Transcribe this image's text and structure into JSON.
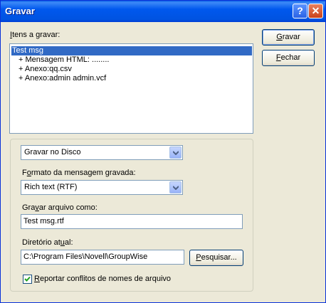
{
  "window": {
    "title": "Gravar",
    "help_glyph": "?",
    "close_glyph": "✕"
  },
  "items_label": {
    "hotkey": "I",
    "rest": "tens a gravar:"
  },
  "items": [
    {
      "label": "Test msg",
      "selected": true
    },
    {
      "label": "+ Mensagem HTML: ........"
    },
    {
      "label": "+ Anexo:qq.csv"
    },
    {
      "label": "+ Anexo:admin admin.vcf"
    }
  ],
  "buttons": {
    "save": {
      "hotkey": "G",
      "rest": "ravar"
    },
    "close": {
      "hotkey": "F",
      "rest": "echar"
    },
    "browse": {
      "hotkey": "P",
      "rest": "esquisar..."
    }
  },
  "destination": {
    "selected": "Gravar no Disco"
  },
  "format": {
    "label_pre": "F",
    "label_hot": "o",
    "label_post": "rmato da mensagem gravada:",
    "selected": "Rich text (RTF)"
  },
  "filename": {
    "label_pre": "Gra",
    "label_hot": "v",
    "label_post": "ar arquivo como:",
    "value": "Test msg.rtf"
  },
  "directory": {
    "label_pre": "Diretório at",
    "label_hot": "u",
    "label_post": "al:",
    "value": "C:\\Program Files\\Novell\\GroupWise"
  },
  "conflicts": {
    "hotkey": "R",
    "rest": "eportar conflitos de nomes de arquivo",
    "checked": true
  },
  "colors": {
    "titlebar": "#0054e3",
    "selection": "#316ac5",
    "face": "#ece9d8"
  }
}
